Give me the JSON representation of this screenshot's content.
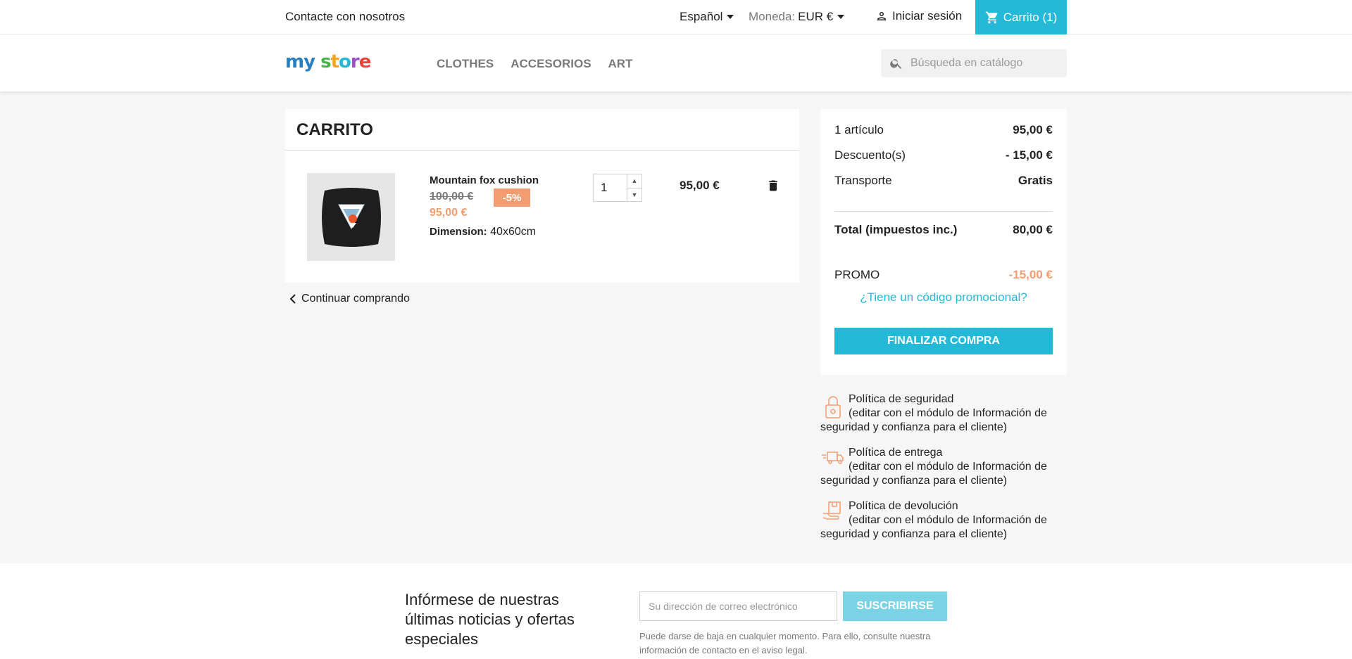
{
  "topbar": {
    "contact": "Contacte con nosotros",
    "language": "Español",
    "currency_label": "Moneda:",
    "currency_value": "EUR €",
    "signin": "Iniciar sesión",
    "cart": "Carrito (1)"
  },
  "header": {
    "logo": "my store",
    "nav": [
      "CLOTHES",
      "ACCESORIOS",
      "ART"
    ],
    "search_placeholder": "Búsqueda en catálogo"
  },
  "cart": {
    "title": "CARRITO",
    "item": {
      "name": "Mountain fox cushion",
      "regular_price": "100,00 €",
      "discount": "-5%",
      "price": "95,00 €",
      "attr_label": "Dimension:",
      "attr_value": "40x60cm",
      "quantity": "1",
      "total": "95,00 €"
    },
    "continue": "Continuar comprando"
  },
  "summary": {
    "items_label": "1 artículo",
    "items_value": "95,00 €",
    "discount_label": "Descuento(s)",
    "discount_value": "- 15,00 €",
    "shipping_label": "Transporte",
    "shipping_value": "Gratis",
    "total_label": "Total (impuestos inc.)",
    "total_value": "80,00 €",
    "promo_label": "PROMO",
    "promo_value": "-15,00 €",
    "promo_link": "¿Tiene un código promocional?",
    "checkout": "FINALIZAR COMPRA"
  },
  "reassurance": [
    {
      "title": "Política de seguridad",
      "text": "(editar con el módulo de Información de seguridad y confianza para el cliente)"
    },
    {
      "title": "Política de entrega",
      "text": "(editar con el módulo de Información de seguridad y confianza para el cliente)"
    },
    {
      "title": "Política de devolución",
      "text": "(editar con el módulo de Información de seguridad y confianza para el cliente)"
    }
  ],
  "newsletter": {
    "title": "Infórmese de nuestras últimas noticias y ofertas especiales",
    "placeholder": "Su dirección de correo electrónico",
    "button": "SUSCRIBIRSE",
    "note": "Puede darse de baja en cualquier momento. Para ello, consulte nuestra información de contacto en el aviso legal."
  },
  "colors": {
    "accent": "#24b9d7",
    "discount": "#f39d72"
  }
}
